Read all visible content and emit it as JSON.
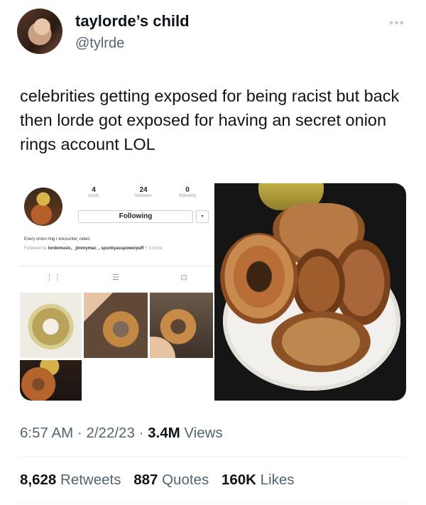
{
  "author": {
    "display_name": "taylorde’s child",
    "handle": "@tylrde",
    "more_icon": "more-horizontal-icon"
  },
  "tweet": {
    "text": "celebrities getting exposed for being racist but back then lorde got exposed for having an secret onion rings account LOL"
  },
  "embedded_profile": {
    "stats": [
      {
        "value": "4",
        "label": "posts"
      },
      {
        "value": "24",
        "label": "followers"
      },
      {
        "value": "0",
        "label": "following"
      }
    ],
    "follow_button": "Following",
    "dropdown_icon": "▾",
    "bio": "Every onion ring I encounter, rated.",
    "followed_by_prefix": "Followed by",
    "followed_by_names": "lordemusic, _jimmymac_, spunkyasspowerpuff",
    "followed_by_more": "+ 3 more",
    "tabs": [
      "grid-icon",
      "list-icon",
      "tagged-icon"
    ]
  },
  "meta": {
    "time": "6:57 AM",
    "date": "2/22/23",
    "views_count": "3.4M",
    "views_label": "Views",
    "separator": "·"
  },
  "engagement": {
    "retweets_count": "8,628",
    "retweets_label": "Retweets",
    "quotes_count": "887",
    "quotes_label": "Quotes",
    "likes_count": "160K",
    "likes_label": "Likes"
  }
}
